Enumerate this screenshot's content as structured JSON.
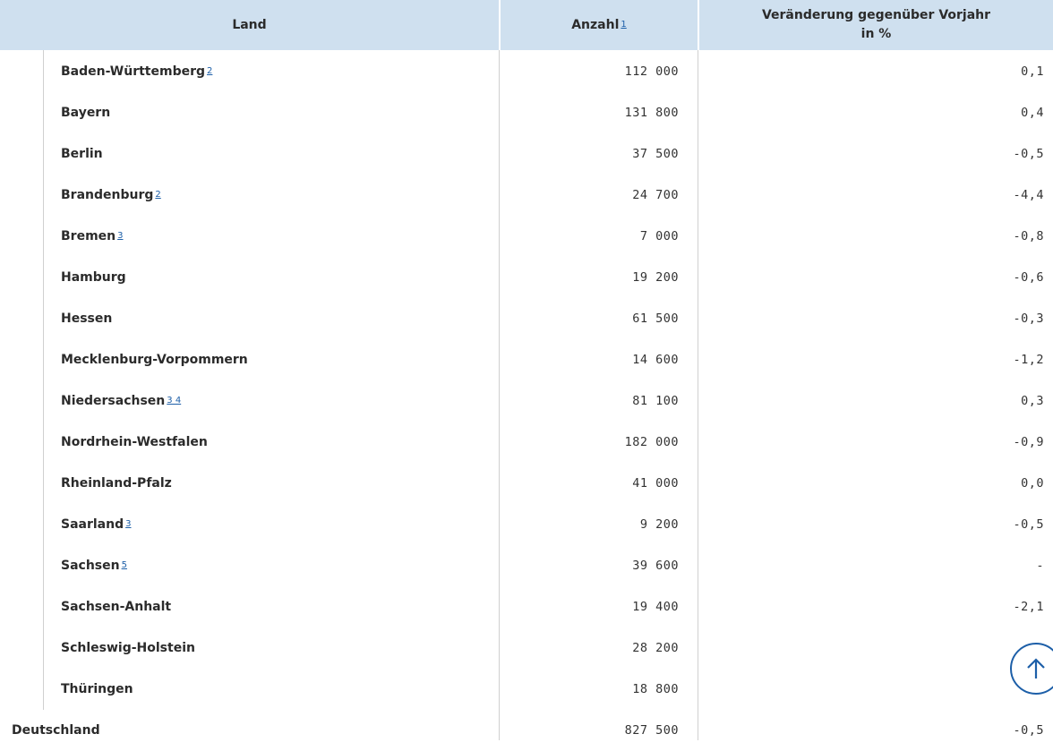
{
  "table": {
    "headers": {
      "land": "Land",
      "anzahl": "Anzahl",
      "anzahl_note": "1",
      "change": "Veränderung gegenüber Vorjahr in %"
    },
    "rows": [
      {
        "land": "Baden-Württemberg",
        "note": "2",
        "anzahl": "112 000",
        "change": "0,1"
      },
      {
        "land": "Bayern",
        "note": "",
        "anzahl": "131 800",
        "change": "0,4"
      },
      {
        "land": "Berlin",
        "note": "",
        "anzahl": "37 500",
        "change": "-0,5"
      },
      {
        "land": "Brandenburg",
        "note": "2",
        "anzahl": "24 700",
        "change": "-4,4"
      },
      {
        "land": "Bremen",
        "note": "3",
        "anzahl": "7 000",
        "change": "-0,8"
      },
      {
        "land": "Hamburg",
        "note": "",
        "anzahl": "19 200",
        "change": "-0,6"
      },
      {
        "land": "Hessen",
        "note": "",
        "anzahl": "61 500",
        "change": "-0,3"
      },
      {
        "land": "Mecklenburg-Vorpommern",
        "note": "",
        "anzahl": "14 600",
        "change": "-1,2"
      },
      {
        "land": "Niedersachsen",
        "note": "3 4",
        "anzahl": "81 100",
        "change": "0,3"
      },
      {
        "land": "Nordrhein-Westfalen",
        "note": "",
        "anzahl": "182 000",
        "change": "-0,9"
      },
      {
        "land": "Rheinland-Pfalz",
        "note": "",
        "anzahl": "41 000",
        "change": "0,0"
      },
      {
        "land": "Saarland",
        "note": "3",
        "anzahl": "9 200",
        "change": "-0,5"
      },
      {
        "land": "Sachsen",
        "note": "5",
        "anzahl": "39 600",
        "change": "-"
      },
      {
        "land": "Sachsen-Anhalt",
        "note": "",
        "anzahl": "19 400",
        "change": "-2,1"
      },
      {
        "land": "Schleswig-Holstein",
        "note": "",
        "anzahl": "28 200",
        "change": ""
      },
      {
        "land": "Thüringen",
        "note": "",
        "anzahl": "18 800",
        "change": ""
      }
    ],
    "total": {
      "land": "Deutschland",
      "anzahl": "827 500",
      "change": "-0,5"
    }
  },
  "scroll_top": {
    "icon": "arrow-up-icon"
  },
  "colors": {
    "header_bg": "#cfe0ef",
    "link": "#1d5fa8",
    "rule": "#d0d0d0"
  }
}
